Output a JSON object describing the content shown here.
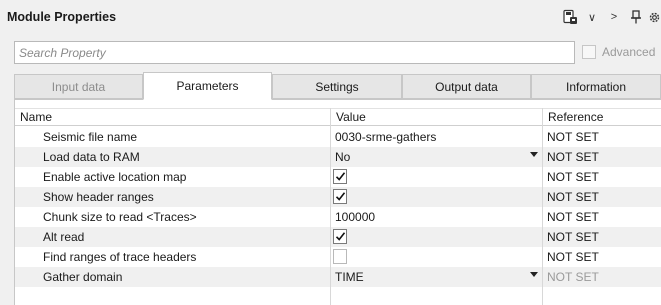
{
  "window": {
    "title": "Module Properties"
  },
  "toolbar": {
    "icons": [
      "save-settings-icon",
      "chevron-down-icon",
      "chevron-right-icon",
      "pin-icon",
      "gear-icon"
    ],
    "chevron_down": "∨",
    "chevron_right": ">"
  },
  "search": {
    "placeholder": "Search Property",
    "value": ""
  },
  "advanced": {
    "label": "Advanced",
    "checked": false
  },
  "tabs": [
    {
      "label": "Input data",
      "state": "disabled"
    },
    {
      "label": "Parameters",
      "state": "active"
    },
    {
      "label": "Settings",
      "state": "normal"
    },
    {
      "label": "Output data",
      "state": "normal"
    },
    {
      "label": "Information",
      "state": "normal"
    }
  ],
  "grid": {
    "columns": [
      "Name",
      "Value",
      "Reference"
    ],
    "rows": [
      {
        "name": "Seismic file name",
        "type": "text",
        "value": "0030-srme-gathers",
        "reference": "NOT SET"
      },
      {
        "name": "Load data to RAM",
        "type": "dropdown",
        "value": "No",
        "reference": "NOT SET"
      },
      {
        "name": "Enable active location map",
        "type": "checkbox",
        "checked": true,
        "reference": "NOT SET"
      },
      {
        "name": "Show header ranges",
        "type": "checkbox",
        "checked": true,
        "reference": "NOT SET"
      },
      {
        "name": "Chunk size to read <Traces>",
        "type": "text",
        "value": "100000",
        "reference": "NOT SET"
      },
      {
        "name": "Alt read",
        "type": "checkbox",
        "checked": true,
        "reference": "NOT SET"
      },
      {
        "name": "Find ranges of trace headers",
        "type": "checkbox",
        "checked": false,
        "reference": "NOT SET"
      },
      {
        "name": "Gather domain",
        "type": "dropdown",
        "value": "TIME",
        "reference": "NOT SET",
        "reference_muted": true
      }
    ]
  }
}
